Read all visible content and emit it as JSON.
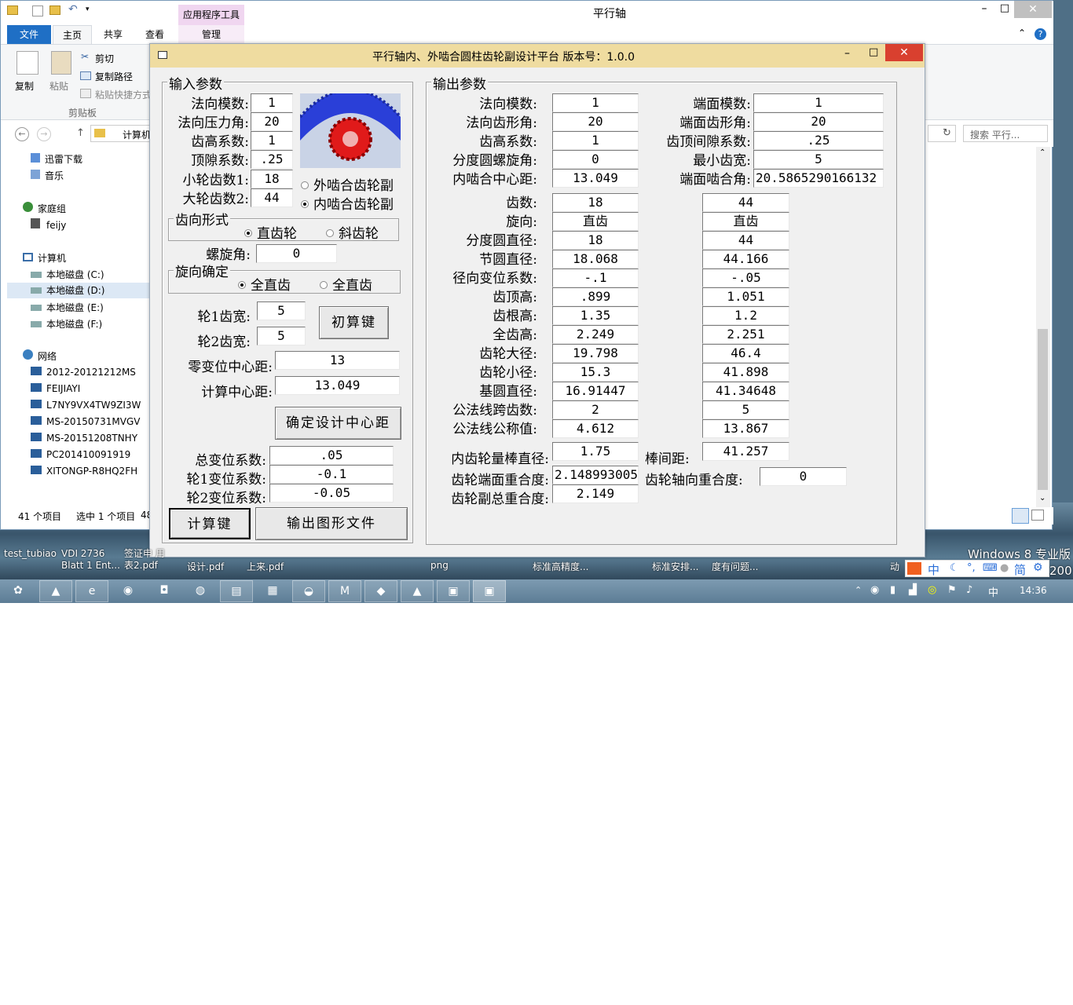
{
  "explorer": {
    "window_title": "平行轴",
    "ribbon_tabs": [
      "文件",
      "主页",
      "共享",
      "查看",
      "管理"
    ],
    "context_tab_label": "应用程序工具",
    "clipboard": {
      "copy": "复制",
      "paste": "粘贴",
      "cut": "剪切",
      "copy_path": "复制路径",
      "paste_shortcut": "粘贴快捷方式",
      "group": "剪贴板"
    },
    "address": "计算机",
    "search_placeholder": "搜索 平行...",
    "sidebar": {
      "favorites": [
        "迅雷下载",
        "音乐"
      ],
      "homegroup": "家庭组",
      "user": "feijy",
      "computer": "计算机",
      "drives": [
        "本地磁盘 (C:)",
        "本地磁盘 (D:)",
        "本地磁盘 (E:)",
        "本地磁盘 (F:)"
      ],
      "network": "网络",
      "hosts": [
        "2012-20121212MS",
        "FEIJIAYI",
        "L7NY9VX4TW9ZI3W",
        "MS-20150731MVGV",
        "MS-20151208TNHY",
        "PC201410091919",
        "XITONGP-R8HQ2FH"
      ]
    },
    "status": {
      "items": "41 个项目",
      "selected": "选中 1 个项目",
      "size": "48"
    }
  },
  "dialog": {
    "title": "平行轴内、外啮合圆柱齿轮副设计平台 版本号：1.0.0",
    "input": {
      "legend": "输入参数",
      "normal_module_label": "法向模数:",
      "normal_module": "1",
      "pressure_angle_label": "法向压力角:",
      "pressure_angle": "20",
      "addendum_coef_label": "齿高系数:",
      "addendum_coef": "1",
      "clearance_coef_label": "顶隙系数:",
      "clearance_coef": ".25",
      "z1_label": "小轮齿数1:",
      "z1": "18",
      "z2_label": "大轮齿数2:",
      "z2": "44",
      "mesh_external": "外啮合齿轮副",
      "mesh_internal": "内啮合齿轮副",
      "tooth_form_legend": "齿向形式",
      "spur": "直齿轮",
      "helical": "斜齿轮",
      "helix_angle_label": "螺旋角:",
      "helix_angle": "0",
      "hand_legend": "旋向确定",
      "hand_opt1": "全直齿",
      "hand_opt2": "全直齿",
      "width1_label": "轮1齿宽:",
      "width1": "5",
      "width2_label": "轮2齿宽:",
      "width2": "5",
      "initial_calc_button": "初算键",
      "std_center_label": "零变位中心距:",
      "std_center": "13",
      "calc_center_label": "计算中心距:",
      "calc_center": "13.049",
      "confirm_center_button": "确定设计中心距",
      "total_shift_label": "总变位系数:",
      "total_shift": ".05",
      "shift1_label": "轮1变位系数:",
      "shift1": "-0.1",
      "shift2_label": "轮2变位系数:",
      "shift2": "-0.05",
      "calc_button": "计算键",
      "export_button": "输出图形文件"
    },
    "output": {
      "legend": "输出参数",
      "top_left": [
        {
          "label": "法向模数:",
          "value": "1"
        },
        {
          "label": "法向齿形角:",
          "value": "20"
        },
        {
          "label": "齿高系数:",
          "value": "1"
        },
        {
          "label": "分度圆螺旋角:",
          "value": "0"
        },
        {
          "label": "内啮合中心距:",
          "value": "13.049"
        }
      ],
      "top_right": [
        {
          "label": "端面模数:",
          "value": "1"
        },
        {
          "label": "端面齿形角:",
          "value": "20"
        },
        {
          "label": "齿顶间隙系数:",
          "value": ".25"
        },
        {
          "label": "最小齿宽:",
          "value": "5"
        },
        {
          "label": "端面啮合角:",
          "value": "20.5865290166132"
        }
      ],
      "rows": [
        {
          "label": "齿数:",
          "g1": "18",
          "g2": "44"
        },
        {
          "label": "旋向:",
          "g1": "直齿",
          "g2": "直齿"
        },
        {
          "label": "分度圆直径:",
          "g1": "18",
          "g2": "44"
        },
        {
          "label": "节圆直径:",
          "g1": "18.068",
          "g2": "44.166"
        },
        {
          "label": "径向变位系数:",
          "g1": "-.1",
          "g2": "-.05"
        },
        {
          "label": "齿顶高:",
          "g1": ".899",
          "g2": "1.051"
        },
        {
          "label": "齿根高:",
          "g1": "1.35",
          "g2": "1.2"
        },
        {
          "label": "全齿高:",
          "g1": "2.249",
          "g2": "2.251"
        },
        {
          "label": "齿轮大径:",
          "g1": "19.798",
          "g2": "46.4"
        },
        {
          "label": "齿轮小径:",
          "g1": "15.3",
          "g2": "41.898"
        },
        {
          "label": "基圆直径:",
          "g1": "16.91447",
          "g2": "41.34648"
        },
        {
          "label": "公法线跨齿数:",
          "g1": "2",
          "g2": "5"
        },
        {
          "label": "公法线公称值:",
          "g1": "4.612",
          "g2": "13.867"
        }
      ],
      "pin_diameter_label": "内齿轮量棒直径:",
      "pin_diameter": "1.75",
      "over_pins_label": "棒间距:",
      "over_pins": "41.257",
      "transverse_contact_label": "齿轮端面重合度:",
      "transverse_contact": "2.148993005",
      "axial_contact_label": "齿轮轴向重合度:",
      "axial_contact": "0",
      "total_contact_label": "齿轮副总重合度:",
      "total_contact": "2.149"
    }
  },
  "desktop": {
    "icons": [
      "test_tubiao",
      "VDI 2736 Blatt 1 Ent...",
      "签证申 用表2.pdf",
      "设计.pdf",
      "上来.pdf",
      "png",
      "标准高精度...",
      "标准安排...",
      "度有问题...",
      "动"
    ],
    "watermark": "Windows 8 专业版",
    "wm_num": "200"
  },
  "taskbar": {
    "clock": "14:36",
    "ime": "中",
    "ime2": "简"
  }
}
